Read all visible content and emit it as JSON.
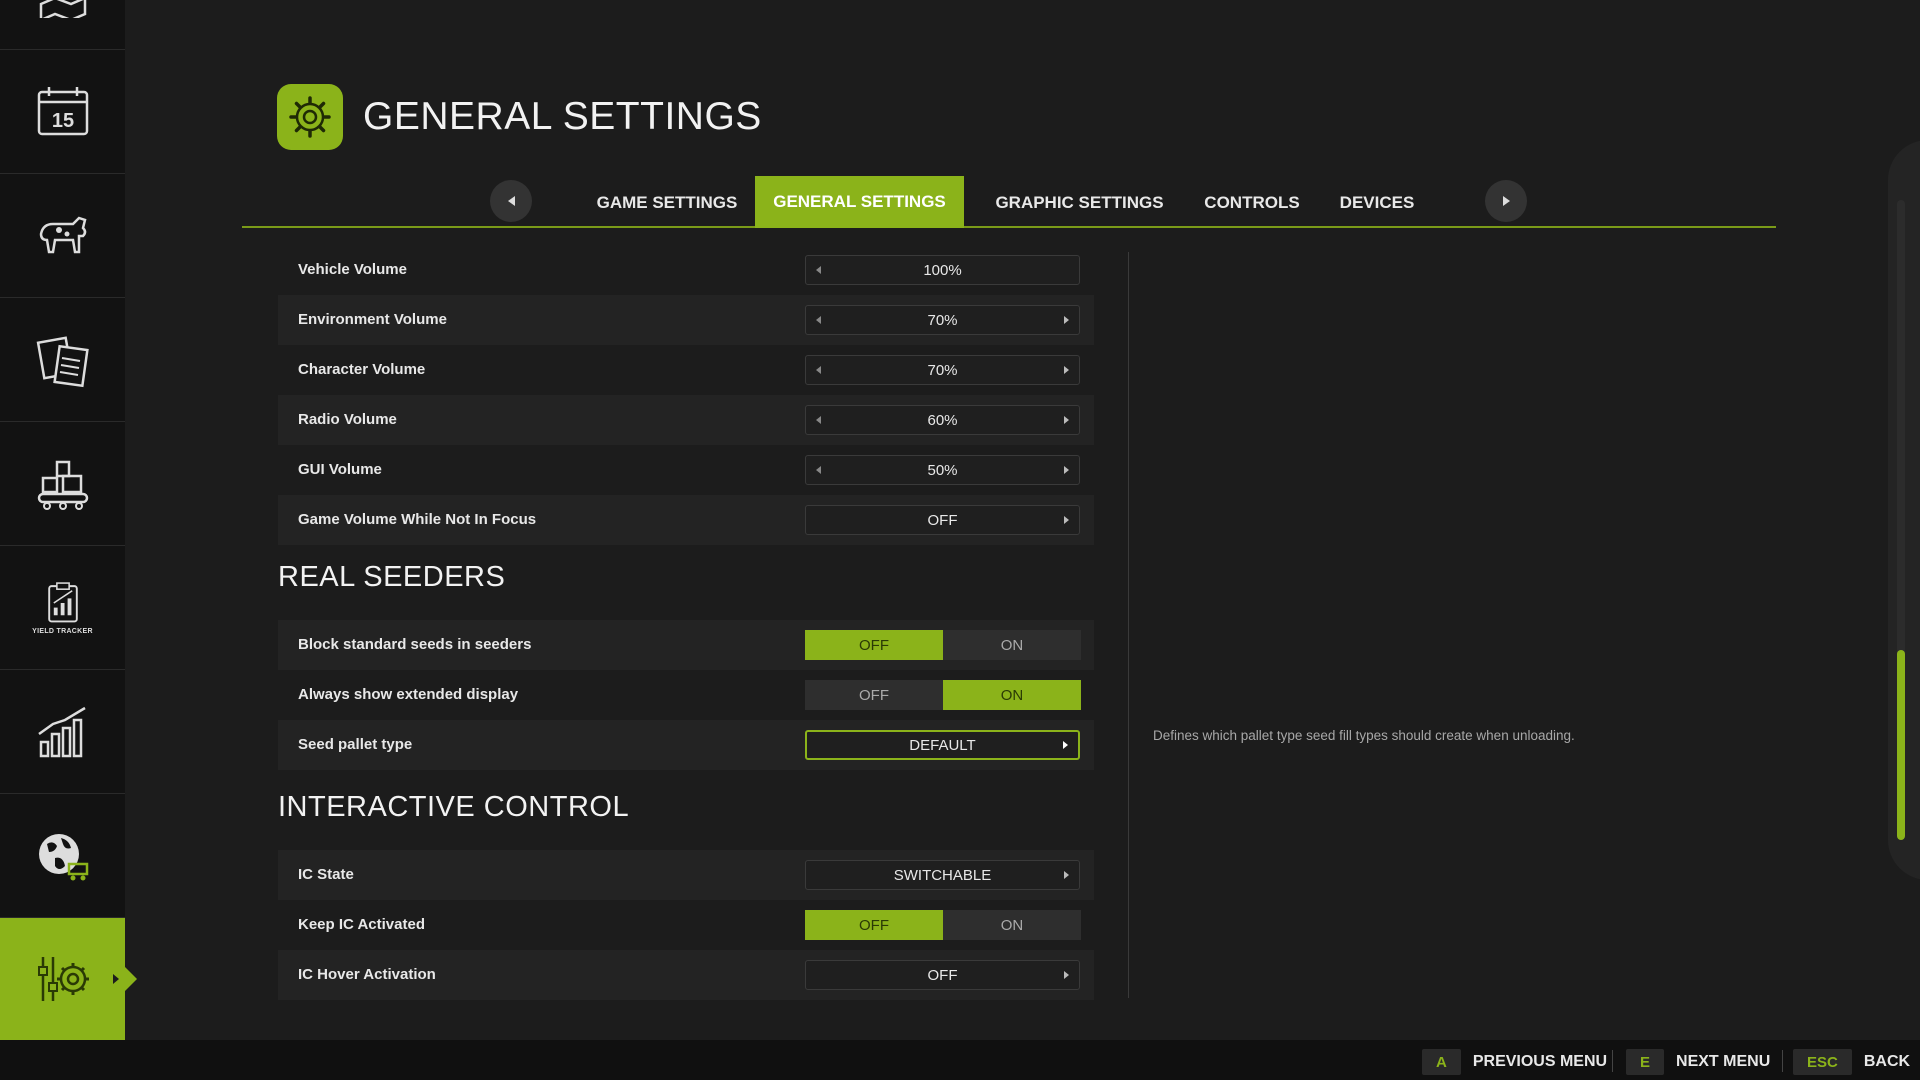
{
  "header": {
    "title": "GENERAL SETTINGS",
    "icon": "gear-icon"
  },
  "sidebar": {
    "items": [
      {
        "name": "map-icon"
      },
      {
        "name": "calendar-icon",
        "text": "15"
      },
      {
        "name": "animals-icon"
      },
      {
        "name": "contracts-icon"
      },
      {
        "name": "production-icon"
      },
      {
        "name": "yield-tracker-icon",
        "text": "YIELD TRACKER"
      },
      {
        "name": "statistics-icon"
      },
      {
        "name": "global-market-icon"
      },
      {
        "name": "settings-icon",
        "active": true
      }
    ]
  },
  "tabs": [
    {
      "label": "GAME SETTINGS"
    },
    {
      "label": "GENERAL SETTINGS",
      "active": true
    },
    {
      "label": "GRAPHIC SETTINGS"
    },
    {
      "label": "CONTROLS"
    },
    {
      "label": "DEVICES"
    }
  ],
  "settings": {
    "vehicle_volume": {
      "label": "Vehicle Volume",
      "value": "100%"
    },
    "environment_volume": {
      "label": "Environment Volume",
      "value": "70%"
    },
    "character_volume": {
      "label": "Character Volume",
      "value": "70%"
    },
    "radio_volume": {
      "label": "Radio Volume",
      "value": "60%"
    },
    "gui_volume": {
      "label": "GUI Volume",
      "value": "50%"
    },
    "game_volume_focus": {
      "label": "Game Volume While Not In Focus",
      "value": "OFF"
    }
  },
  "real_seeders": {
    "title": "REAL SEEDERS",
    "block_seeds": {
      "label": "Block standard seeds in seeders",
      "off": "OFF",
      "on": "ON",
      "selected": "OFF"
    },
    "extended_display": {
      "label": "Always show extended display",
      "off": "OFF",
      "on": "ON",
      "selected": "ON"
    },
    "seed_pallet": {
      "label": "Seed pallet type",
      "value": "DEFAULT"
    }
  },
  "interactive_control": {
    "title": "INTERACTIVE CONTROL",
    "ic_state": {
      "label": "IC State",
      "value": "SWITCHABLE"
    },
    "keep_ic": {
      "label": "Keep IC Activated",
      "off": "OFF",
      "on": "ON",
      "selected": "OFF"
    },
    "ic_hover": {
      "label": "IC Hover Activation",
      "value": "OFF"
    }
  },
  "help_text": "Defines which pallet type seed fill types should create when unloading.",
  "footer": {
    "prev": {
      "key": "A",
      "label": "PREVIOUS MENU"
    },
    "next": {
      "key": "E",
      "label": "NEXT MENU"
    },
    "back": {
      "key": "ESC",
      "label": "BACK"
    }
  },
  "colors": {
    "accent": "#8bb31a",
    "background": "#1c1c1c",
    "sidebar": "#121212"
  }
}
